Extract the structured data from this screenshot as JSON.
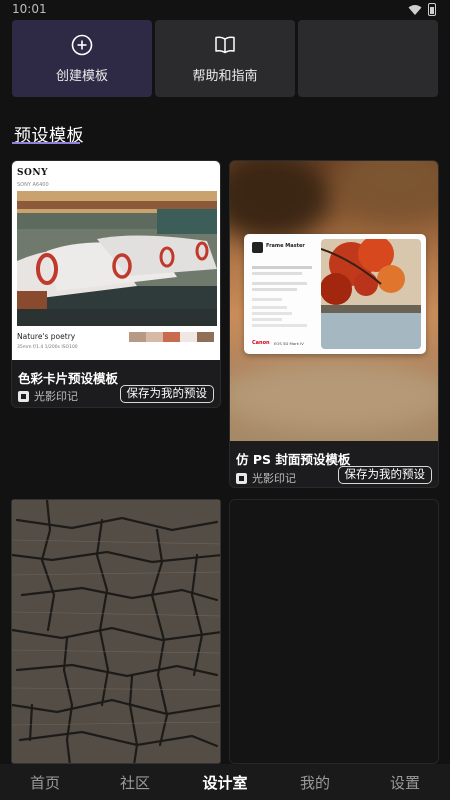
{
  "status_bar": {
    "time": "10:01"
  },
  "actions": {
    "create_label": "创建模板",
    "help_label": "帮助和指南"
  },
  "section": {
    "title": "预设模板"
  },
  "templates": [
    {
      "title": "色彩卡片预设模板",
      "author": "光影印记",
      "save_label": "保存为我的预设",
      "preview": {
        "brand": "SONY",
        "model": "SONY A6400",
        "caption": "Nature's poetry",
        "exif": "35mm    f/1.4    1/200s    ISO100",
        "swatch_colors": [
          "#b79a86",
          "#d7b9a8",
          "#c86b4e",
          "#efe7e2",
          "#8f6f58"
        ]
      }
    },
    {
      "title": "仿 PS 封面预设模板",
      "author": "光影印记",
      "save_label": "保存为我的预设",
      "preview": {
        "app_name": "Frame Master",
        "brand": "Canon",
        "camera": "EOS 5D Mark IV"
      }
    },
    {
      "title": "",
      "author": "",
      "save_label": ""
    },
    {
      "title": "",
      "author": "",
      "save_label": ""
    }
  ],
  "bottom_nav": {
    "items": [
      {
        "label": "首页"
      },
      {
        "label": "社区"
      },
      {
        "label": "设计室"
      },
      {
        "label": "我的"
      },
      {
        "label": "设置"
      }
    ],
    "active_label": "设计室"
  }
}
